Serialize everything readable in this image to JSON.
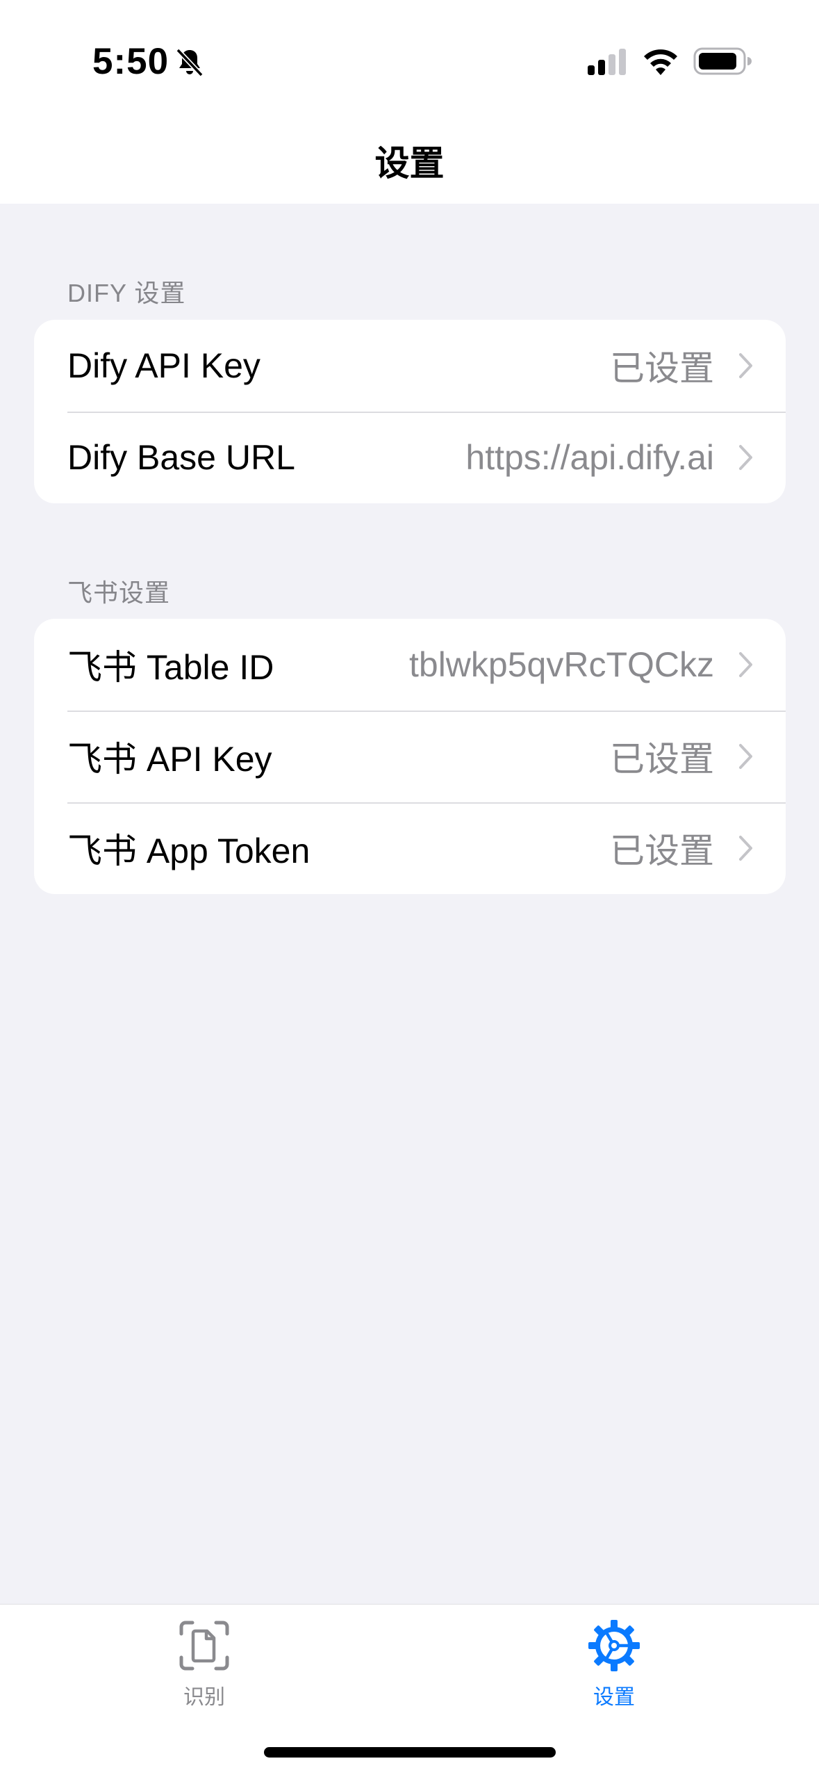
{
  "status_bar": {
    "time": "5:50",
    "icons": [
      "bell-slash-icon",
      "cellular-signal-icon",
      "wifi-icon",
      "battery-icon"
    ]
  },
  "nav": {
    "title": "设置"
  },
  "sections": [
    {
      "header": "DIFY 设置",
      "rows": [
        {
          "label": "Dify API Key",
          "value": "已设置"
        },
        {
          "label": "Dify Base URL",
          "value": "https://api.dify.ai"
        }
      ]
    },
    {
      "header": "飞书设置",
      "rows": [
        {
          "label": "飞书 Table ID",
          "value": "tblwkp5qvRcTQCkz"
        },
        {
          "label": "飞书 API Key",
          "value": "已设置"
        },
        {
          "label": "飞书 App Token",
          "value": "已设置"
        }
      ]
    }
  ],
  "tab_bar": {
    "tabs": [
      {
        "label": "识别",
        "icon": "document-scan-icon",
        "selected": false
      },
      {
        "label": "设置",
        "icon": "gear-icon",
        "selected": true
      }
    ],
    "accent_color": "#0a7aff"
  }
}
